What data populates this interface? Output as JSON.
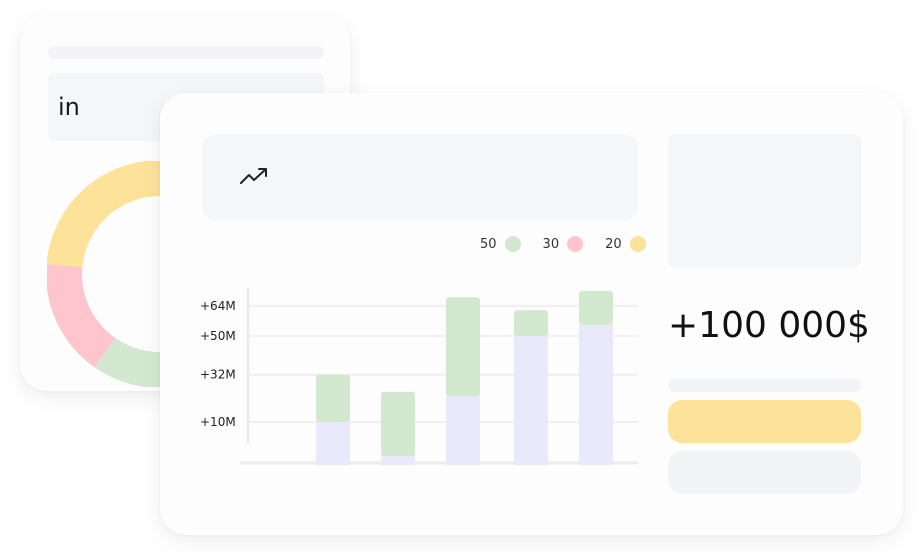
{
  "back_card": {
    "header_label": "in"
  },
  "donut": {
    "segments": [
      {
        "value": 35,
        "color": "#fde29a"
      },
      {
        "value": 20,
        "color": "#ffc5ce"
      },
      {
        "value": 45,
        "color": "#d2e9d0"
      }
    ]
  },
  "legend": [
    {
      "value": "50",
      "color": "#d2e9d0"
    },
    {
      "value": "30",
      "color": "#ffc5ce"
    },
    {
      "value": "20",
      "color": "#fde29a"
    }
  ],
  "amount": "+100 000$",
  "icons": {
    "trend": "trending-up-icon"
  },
  "chart_data": {
    "type": "bar",
    "stacked": true,
    "y_ticks": [
      "+64M",
      "+50M",
      "+32M",
      "+10M"
    ],
    "y_tick_values": [
      64,
      50,
      32,
      10
    ],
    "ylim": [
      -10,
      70
    ],
    "categories": [
      "",
      "",
      "",
      "",
      ""
    ],
    "series": [
      {
        "values": [
          10,
          -6,
          22,
          50,
          55
        ],
        "color": "#eae9fb"
      },
      {
        "values": [
          22,
          30,
          46,
          12,
          16
        ],
        "color": "#d2e9d0"
      }
    ],
    "grid": true
  }
}
